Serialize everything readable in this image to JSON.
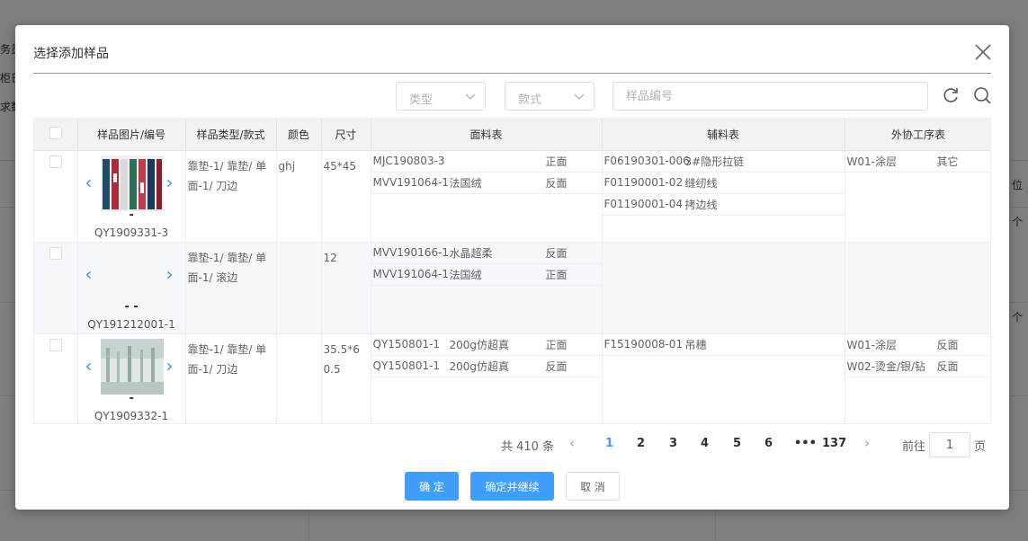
{
  "background": {
    "left_fragments": [
      "务员",
      "柜日",
      "求数"
    ],
    "right_fragments": [
      "位",
      "个",
      "个"
    ]
  },
  "dialog": {
    "title": "选择添加样品"
  },
  "filters": {
    "type_placeholder": "类型",
    "style_placeholder": "款式",
    "search_placeholder": "样品编号"
  },
  "table": {
    "headers": [
      "样品图片/编号",
      "样品类型/款式",
      "颜色",
      "尺寸",
      "面料表",
      "辅料表",
      "外协工序表"
    ],
    "rows": [
      {
        "code": "QY1909331-3",
        "dash": "-",
        "type": "靠垫-1/ 靠垫/ 单面-1/ 刀边",
        "color": "ghj",
        "size": "45*45",
        "fabrics": [
          {
            "code": "MJC190803-3",
            "name": "",
            "side": "正面"
          },
          {
            "code": "MVV191064-1",
            "name": "法国绒",
            "side": "反面"
          }
        ],
        "accessories": [
          {
            "code": "F06190301-006",
            "name": "3#隐形拉链"
          },
          {
            "code": "F01190001-02",
            "name": "缝纫线"
          },
          {
            "code": "F01190001-04",
            "name": "拷边线"
          }
        ],
        "processes": [
          {
            "code": "W01-涂层",
            "note": "其它"
          }
        ]
      },
      {
        "code": "QY191212001-1",
        "dash": "- -",
        "type": "靠垫-1/ 靠垫/ 单面-1/ 滚边",
        "color": "",
        "size": "12",
        "fabrics": [
          {
            "code": "MVV190166-1",
            "name": "水晶超柔",
            "side": "反面"
          },
          {
            "code": "MVV191064-1",
            "name": "法国绒",
            "side": "正面"
          }
        ],
        "accessories": [],
        "processes": []
      },
      {
        "code": "QY1909332-1",
        "dash": "-",
        "type": "靠垫-1/ 靠垫/ 单面-1/ 刀边",
        "color": "",
        "size": "35.5*60.5",
        "fabrics": [
          {
            "code": "QY150801-1",
            "name": "200g仿超真",
            "side": "正面"
          },
          {
            "code": "QY150801-1",
            "name": "200g仿超真",
            "side": "反面"
          }
        ],
        "accessories": [
          {
            "code": "F15190008-01",
            "name": "吊穗"
          }
        ],
        "processes": [
          {
            "code": "W01-涂层",
            "note": "反面"
          },
          {
            "code": "W02-烫金/银/钻",
            "note": "反面"
          }
        ]
      }
    ]
  },
  "pagination": {
    "total": "共 410 条",
    "pages": [
      "1",
      "2",
      "3",
      "4",
      "5",
      "6",
      "•••",
      "137"
    ],
    "current": "1",
    "goto_label": "前往",
    "goto_value": "1",
    "goto_suffix": "页"
  },
  "buttons": {
    "confirm": "确 定",
    "confirm_continue": "确定并继续",
    "cancel": "取 消"
  },
  "colors": {
    "primary": "#409eff",
    "arrow": "#4a90e2"
  }
}
